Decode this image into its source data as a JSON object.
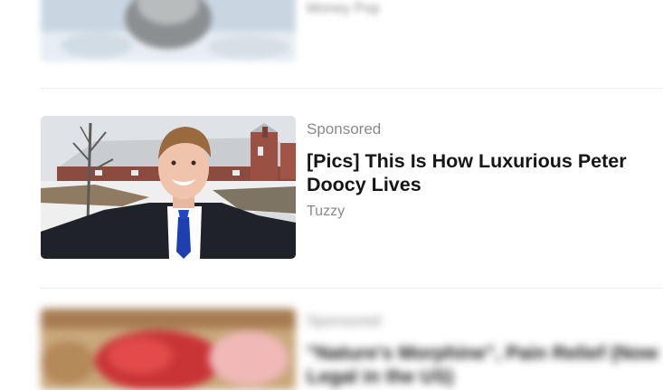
{
  "feed": {
    "items": [
      {
        "label": "",
        "title": "",
        "source": "Money Pop",
        "thumbnail_icon": "snow-globe-photo"
      },
      {
        "label": "Sponsored",
        "title_line1": "[Pics] This Is How Luxurious Peter",
        "title_line2": "Doocy Lives",
        "source": "Tuzzy",
        "thumbnail_icon": "man-in-suit-photo"
      },
      {
        "label": "Sponsored",
        "title_line1": "\"Nature's Morphine\", Pain Relief (Now",
        "title_line2": "Legal in the US)",
        "thumbnail_icon": "food-photo"
      }
    ]
  },
  "colors": {
    "title": "#161616",
    "meta": "#8a8a8a",
    "divider": "#ececec"
  }
}
